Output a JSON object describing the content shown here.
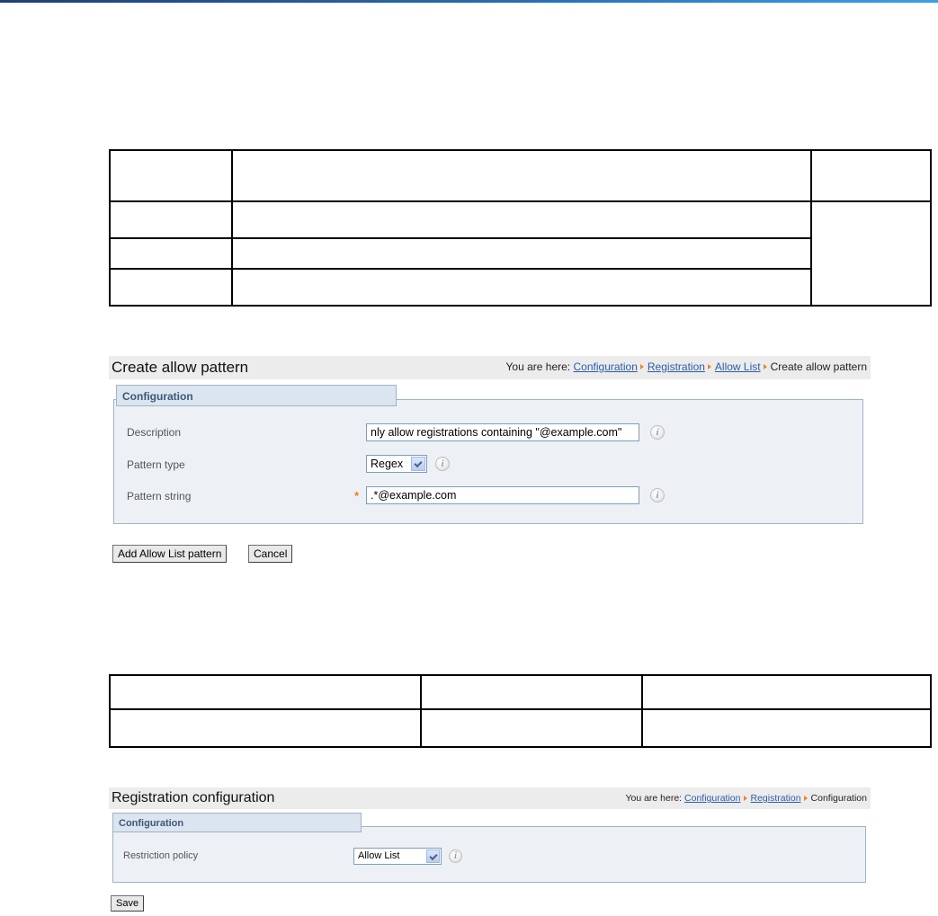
{
  "create_pattern": {
    "title": "Create allow pattern",
    "breadcrumb_prefix": "You are here:",
    "breadcrumbs": [
      "Configuration",
      "Registration",
      "Allow List"
    ],
    "breadcrumb_current": "Create allow pattern",
    "section_title": "Configuration",
    "fields": {
      "description_label": "Description",
      "description_value": "nly allow registrations containing \"@example.com\"",
      "pattern_type_label": "Pattern type",
      "pattern_type_value": "Regex",
      "pattern_string_label": "Pattern string",
      "pattern_string_value": ".*@example.com",
      "required_mark": "*"
    },
    "buttons": {
      "add": "Add Allow List pattern",
      "cancel": "Cancel"
    }
  },
  "registration_config": {
    "title": "Registration configuration",
    "breadcrumb_prefix": "You are here:",
    "breadcrumbs": [
      "Configuration",
      "Registration"
    ],
    "breadcrumb_current": "Configuration",
    "section_title": "Configuration",
    "fields": {
      "restriction_policy_label": "Restriction policy",
      "restriction_policy_value": "Allow List"
    },
    "buttons": {
      "save": "Save"
    }
  },
  "icons": {
    "info": "i"
  },
  "colors": {
    "link": "#2c5da9",
    "breadcrumb_separator": "#e8872a",
    "required": "#f07a1a",
    "legend_text": "#3b5878"
  }
}
